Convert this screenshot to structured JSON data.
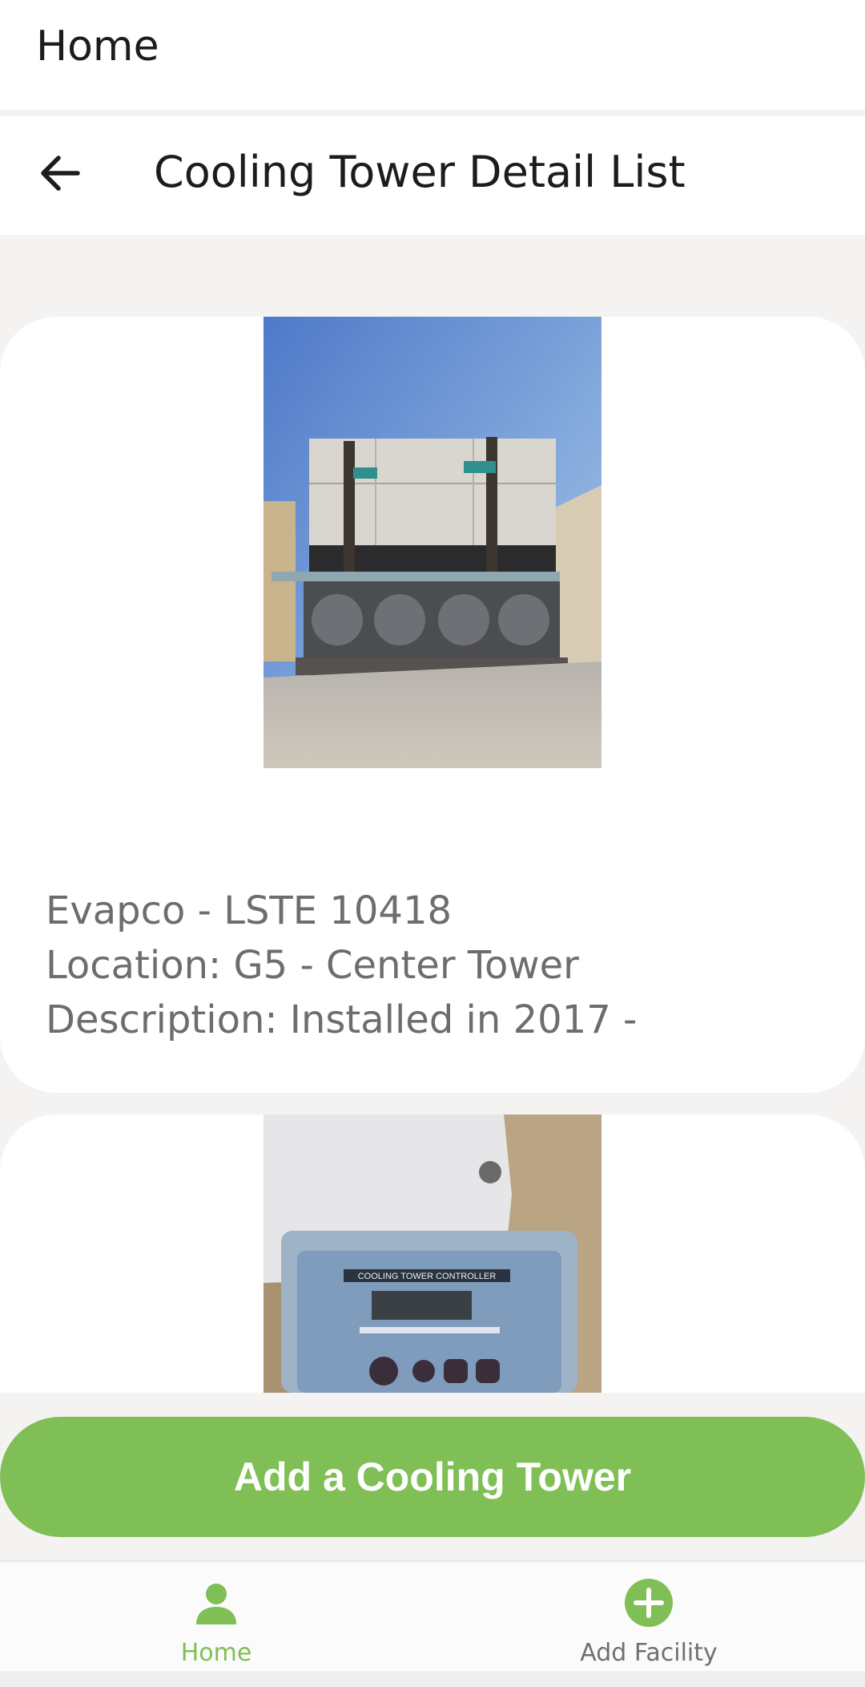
{
  "app_header": {
    "title": "Home"
  },
  "sub_header": {
    "title": "Cooling Tower Detail List"
  },
  "towers": [
    {
      "name_line": "Evapco - LSTE 10418",
      "location_line": "Location: G5 - Center Tower",
      "description_line": "Description: Installed in 2017 -",
      "photo": "cooling-tower-photo"
    },
    {
      "photo": "cooling-tower-controller-photo",
      "controller_label": "COOLING TOWER CONTROLLER"
    }
  ],
  "add_button": {
    "label": "Add a Cooling Tower"
  },
  "bottom_nav": {
    "items": [
      {
        "label": "Home",
        "icon": "person-icon",
        "active": true
      },
      {
        "label": "Add Facility",
        "icon": "plus-circle-icon",
        "active": false
      }
    ]
  },
  "colors": {
    "accent": "#7fbf55",
    "background": "#f5f2f2",
    "card": "#ffffff",
    "detail_text": "#6d6d6d"
  }
}
